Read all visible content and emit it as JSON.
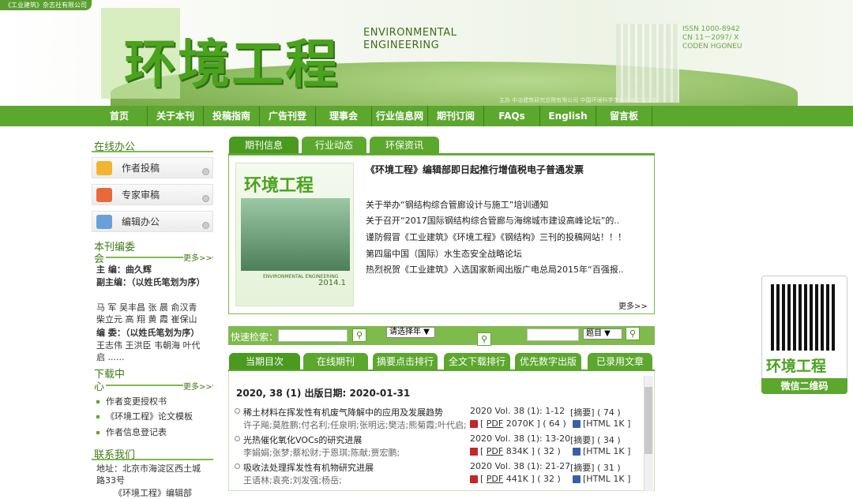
{
  "header": {
    "corp_label": "《工业建筑》杂志社有限公司",
    "logo_cn": "环境工程",
    "logo_en_line1": "ENVIRONMENTAL",
    "logo_en_line2": "ENGINEERING",
    "issn": "ISSN 1000-8942",
    "cn": "CN 11－2097/ X",
    "coden": "CODEN HGONEU",
    "sponsor": "主办 中冶建筑研究总院有限公司    中国环境科学学会环境工程分会"
  },
  "nav": [
    "首页",
    "关于本刊",
    "投稿指南",
    "广告刊登",
    "理事会",
    "行业信息网",
    "期刊订阅",
    "FAQs",
    "English",
    "留言板"
  ],
  "sidebar": {
    "online_title": "在线办公",
    "online_items": [
      "作者投稿",
      "专家审稿",
      "编辑办公"
    ],
    "editors_title_1": "本刊编委",
    "editors_title_2": "会",
    "more": "更多>>",
    "chief_editor": "主 编：曲久辉",
    "vice_label": "副主编：（以姓氏笔划为序）",
    "vice_names": "马 军 吴丰昌 张 晨 俞汉青 柴立元 高 翔 黄 霞 崔保山",
    "members_label": "编 委：（以姓氏笔划为序）",
    "members_names": "王志伟 王洪臣 韦朝海 叶代启 ......",
    "download_title_1": "下载中",
    "download_title_2": "心",
    "downloads": [
      "作者变更授权书",
      "《环境工程》论文模板",
      "作者信息登记表"
    ],
    "contact_title": "联系我们",
    "address": "地址：北京市海淀区西土城路33号",
    "address_more": "《环境工程》编辑部"
  },
  "news_tabs": [
    "期刊信息",
    "行业动态",
    "环保资讯"
  ],
  "cover": {
    "title": "环境工程",
    "en": "ENVIRONMENTAL ENGINEERING",
    "issue": "2014.1"
  },
  "news": {
    "headline": "《环境工程》编辑部即日起推行增值税电子普通发票",
    "items": [
      "关于举办“钢结构综合管廊设计与施工”培训通知",
      "关于召开“2017国际钢结构综合管廊与海绵城市建设高峰论坛”的..",
      "谨防假冒《工业建筑》《环境工程》《钢结构》三刊的投稿网站！！！",
      "第四届中国（国际）水生态安全战略论坛",
      "热烈祝贺《工业建筑》入选国家新闻出版广电总局2015年“百强报.."
    ],
    "more": "更多>>"
  },
  "search": {
    "label": "快速检索：",
    "year_select": "请选择年",
    "field_select": "题目"
  },
  "issue_tabs": [
    "当期目次",
    "在线期刊",
    "摘要点击排行",
    "全文下载排行",
    "优先数字出版",
    "已录用文章"
  ],
  "issue": {
    "header": "2020, 38 (1)   出版日期: 2020-01-31",
    "articles": [
      {
        "title": "稀土材料在挥发性有机废气降解中的应用及发展趋势",
        "authors": "许子飚;莫胜鹏;付名利;任泉明;张明远;樊洁;熊菊霞;叶代启;",
        "vol": "2020 Vol. 38 (1): 1-12",
        "abs": "[摘要] ( 74 )",
        "pdf": "PDF",
        "pdf_size": "2070K ] ( 64 )",
        "html": "[HTML 1K ]"
      },
      {
        "title": "光热催化氧化VOCs的研究进展",
        "authors": "李娟娟;张梦;蔡松财;于恩琪;陈献;贾宏鹏;",
        "vol": "2020 Vol. 38 (1): 13-20",
        "abs": "[摘要] ( 34 )",
        "pdf": "PDF",
        "pdf_size": "834K ] ( 32 )",
        "html": "[HTML 1K ]"
      },
      {
        "title": "吸收法处理挥发性有机物研究进展",
        "authors": "王语林;袁亮;刘发强;杨岳;",
        "vol": "2020 Vol. 38 (1): 21-27",
        "abs": "[摘要] ( 31 )",
        "pdf": "PDF",
        "pdf_size": "441K ] ( 32 )",
        "html": "[HTML 1K ]"
      }
    ]
  },
  "qr": {
    "logo": "环境工程",
    "label": "微信二维码"
  }
}
